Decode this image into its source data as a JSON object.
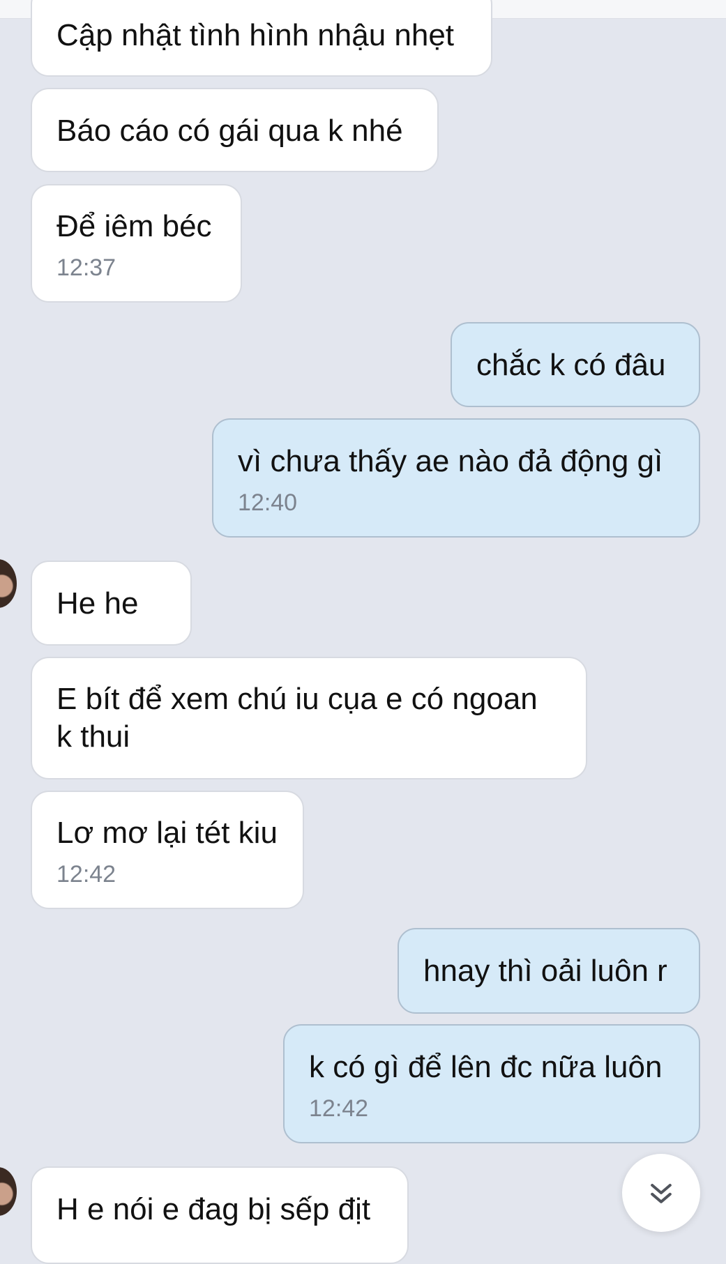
{
  "messages": [
    {
      "text": "Cập nhật tình hình nhậu nhẹt",
      "time": ""
    },
    {
      "text": "Báo cáo có gái qua k nhé",
      "time": ""
    },
    {
      "text": "Để iêm béc",
      "time": "12:37"
    },
    {
      "text": "chắc k có đâu",
      "time": ""
    },
    {
      "text": "vì chưa thấy ae nào đả động gì",
      "time": "12:40"
    },
    {
      "text": "He he",
      "time": ""
    },
    {
      "text": "E bít để xem chú iu cụa e có ngoan\nk thui",
      "time": ""
    },
    {
      "text": "Lơ mơ lại tét kiu",
      "time": "12:42"
    },
    {
      "text": "hnay thì oải luôn r",
      "time": ""
    },
    {
      "text": "k có gì để lên đc nữa luôn",
      "time": "12:42"
    },
    {
      "text": "H e nói e đag bị sếp địt",
      "time": ""
    }
  ],
  "icons": {
    "scroll_down": "double-chevron-down-icon",
    "avatar": "avatar"
  }
}
